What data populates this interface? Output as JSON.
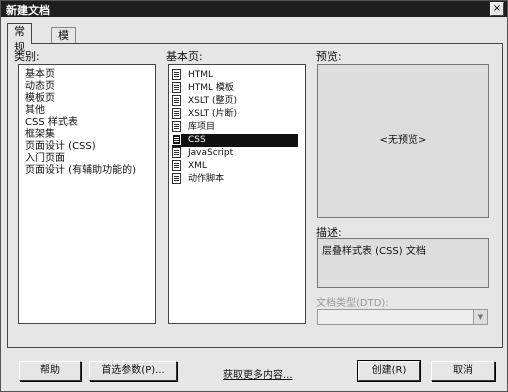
{
  "window": {
    "title": "新建文档",
    "close_glyph": "×"
  },
  "tabs": [
    {
      "label": "常规",
      "active": true
    },
    {
      "label": "模板",
      "active": false
    }
  ],
  "category": {
    "label": "类别:",
    "items": [
      "基本页",
      "动态页",
      "模板页",
      "其他",
      "CSS 样式表",
      "框架集",
      "页面设计 (CSS)",
      "入门页面",
      "页面设计 (有辅助功能的)"
    ]
  },
  "basic_page": {
    "label": "基本页:",
    "items": [
      "HTML",
      "HTML 模板",
      "XSLT (整页)",
      "XSLT (片断)",
      "库项目",
      "CSS",
      "JavaScript",
      "XML",
      "动作脚本"
    ],
    "selected": "CSS"
  },
  "preview": {
    "label": "预览:",
    "text": "<无预览>"
  },
  "description": {
    "label": "描述:",
    "text": "层叠样式表 (CSS) 文档"
  },
  "doctype": {
    "label": "文档类型(DTD):",
    "value": ""
  },
  "buttons": {
    "help": "帮助",
    "prefs": "首选参数(P)...",
    "more": "获取更多内容...",
    "create": "创建(R)",
    "cancel": "取消"
  },
  "colors": {
    "titlebar": "#1e1e1e",
    "selection": "#111111",
    "dialog_bg": "#e6e6e6"
  }
}
